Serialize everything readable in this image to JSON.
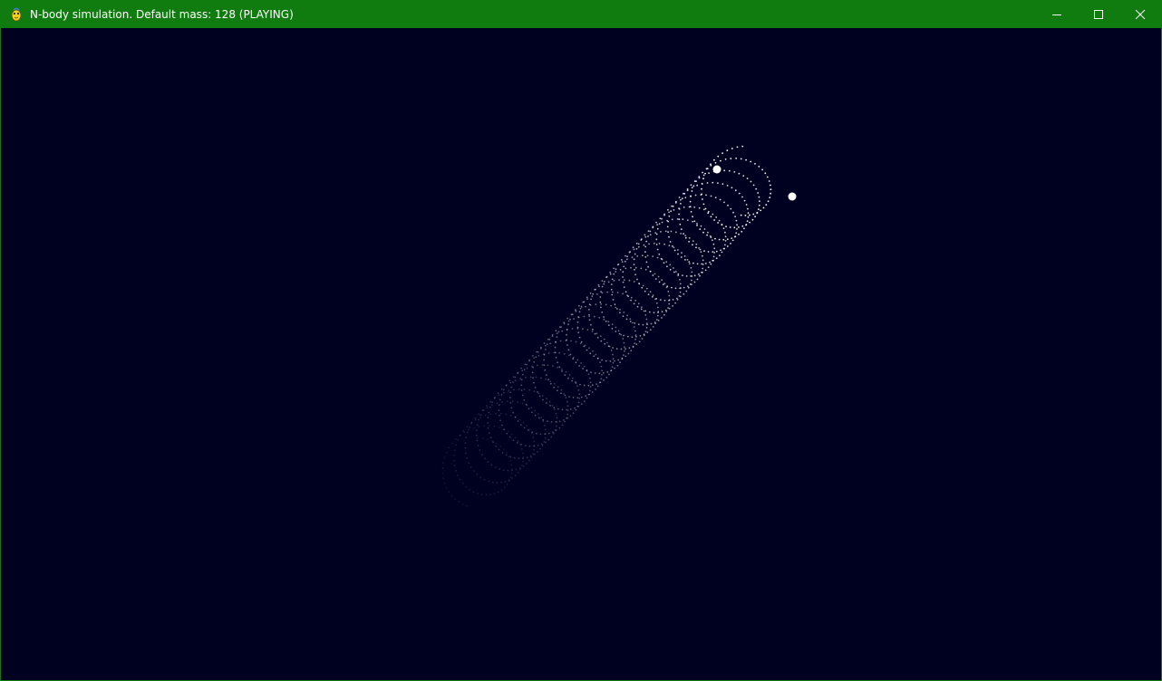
{
  "window": {
    "title": "N-body simulation. Default mass: 128 (PLAYING)",
    "app_icon": "pygame-snake-icon",
    "controls": [
      {
        "name": "minimize",
        "icon": "minimize-icon"
      },
      {
        "name": "maximize",
        "icon": "maximize-icon"
      },
      {
        "name": "close",
        "icon": "close-icon"
      }
    ],
    "accent_color": "#107c10"
  },
  "simulation": {
    "background_color": "#000020",
    "trail_color": "#ffffff",
    "bodies": 2
  }
}
